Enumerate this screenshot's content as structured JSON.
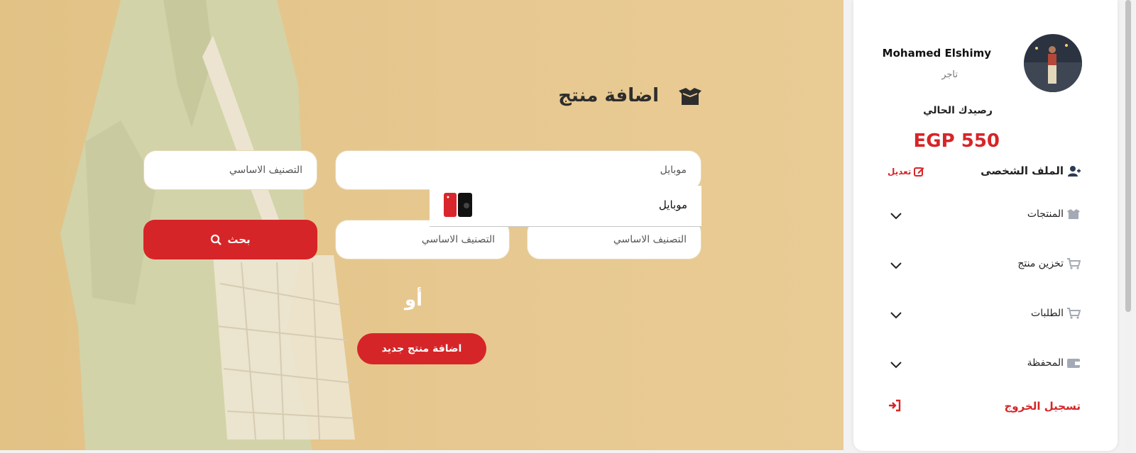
{
  "main": {
    "title": "اضافة منتج",
    "main_field": "موبايل",
    "category_label": "التصنيف الاساسي",
    "dropdown_option": "موبايل",
    "search_label": "بحث",
    "or_label": "أو",
    "add_new_label": "اضافة منتج جديد"
  },
  "sidebar": {
    "user_name": "Mohamed Elshimy",
    "user_role": "تاجر",
    "balance_label": "رصيدك الحالي",
    "balance_value": "EGP 550",
    "profile_label": "الملف الشخصى",
    "edit_label": "تعديل",
    "menu": [
      {
        "label": "المنتجات",
        "icon": "box-icon"
      },
      {
        "label": "تخزين منتج",
        "icon": "cart-icon"
      },
      {
        "label": "الطلبات",
        "icon": "cart-icon"
      },
      {
        "label": "المحفظة",
        "icon": "wallet-icon"
      }
    ],
    "logout_label": "تسجيل الخروج"
  },
  "colors": {
    "accent": "#d62528",
    "hero_bg": "#e4c58b"
  }
}
